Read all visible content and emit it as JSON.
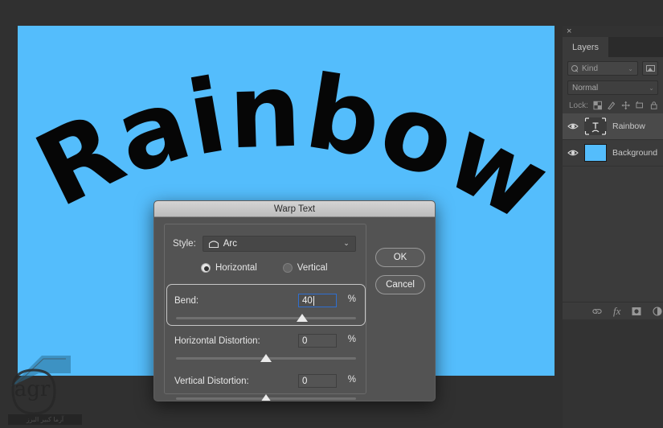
{
  "app": {
    "canvas_background_color": "#54bdfc",
    "workspace_background_color": "#303030",
    "artwork_text": "Rainbow",
    "artwork_text_color": "#060606"
  },
  "dock": {
    "close_glyph": "×",
    "tabs": [
      {
        "label": "Layers",
        "active": true
      },
      {
        "label": "",
        "active": false
      }
    ],
    "filter": {
      "search_icon": "search-icon",
      "kind_label": "Kind",
      "chevron": "⌄",
      "pixel_filter_icon": "pixel-layer-filter-icon"
    },
    "blend": {
      "mode": "Normal",
      "chevron": "⌄"
    },
    "lock": {
      "label": "Lock:",
      "icons": [
        "transparent-pixels-icon",
        "brush-icon",
        "move-icon",
        "artboard-nesting-icon",
        "lock-all-icon"
      ]
    },
    "layers": [
      {
        "name": "Rainbow",
        "visible": true,
        "selected": true,
        "thumbnail_type": "warped-text",
        "eye_icon": "eye-icon"
      },
      {
        "name": "Background",
        "visible": true,
        "selected": false,
        "thumbnail_type": "solid-color",
        "thumbnail_color": "#54bdfc",
        "eye_icon": "eye-icon"
      }
    ],
    "footer_icons": [
      "link-layers-icon",
      "layer-style-fx-icon",
      "layer-mask-icon",
      "adjustment-layer-icon"
    ]
  },
  "dialog": {
    "title": "Warp Text",
    "style": {
      "label": "Style:",
      "value": "Arc",
      "icon": "arc-warp-icon",
      "chevron": "⌄"
    },
    "orientation": {
      "horizontal_label": "Horizontal",
      "vertical_label": "Vertical",
      "selected": "Horizontal"
    },
    "sliders": [
      {
        "id": "bend",
        "label": "Bend:",
        "value": "40",
        "unit": "%",
        "knob_percent": 70,
        "focused": true,
        "highlighted": true
      },
      {
        "id": "horizontal-distortion",
        "label": "Horizontal Distortion:",
        "value": "0",
        "unit": "%",
        "knob_percent": 50,
        "focused": false,
        "highlighted": false
      },
      {
        "id": "vertical-distortion",
        "label": "Vertical Distortion:",
        "value": "0",
        "unit": "%",
        "knob_percent": 50,
        "focused": false,
        "highlighted": false
      }
    ],
    "buttons": {
      "ok": "OK",
      "cancel": "Cancel"
    },
    "focus_border_color": "#2f6fd0"
  },
  "watermark": {
    "logo_text": "agr",
    "caption": "آرما کبیر البرز"
  }
}
